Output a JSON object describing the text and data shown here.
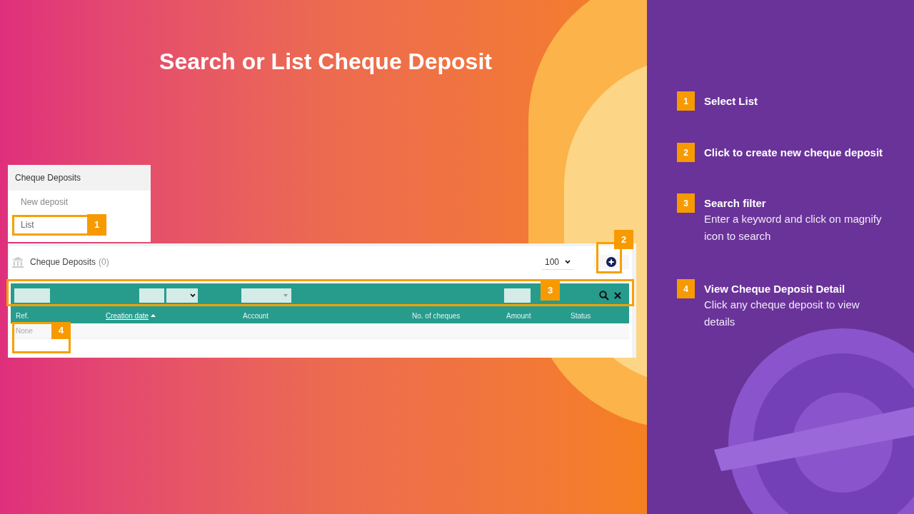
{
  "title": "Search or List Cheque Deposit",
  "menu": {
    "heading": "Cheque Deposits",
    "items": [
      {
        "label": "New deposit",
        "selected": false
      },
      {
        "label": "List",
        "selected": true
      }
    ]
  },
  "list_panel": {
    "title": "Cheque Deposits",
    "count": "(0)",
    "page_size": "100",
    "columns": [
      {
        "label": "Ref.",
        "sorted": false
      },
      {
        "label": "Creation date",
        "sorted": true
      },
      {
        "label": "Account",
        "sorted": false
      },
      {
        "label": "No. of cheques",
        "sorted": false
      },
      {
        "label": "Amount",
        "sorted": false
      },
      {
        "label": "Status",
        "sorted": false
      }
    ],
    "empty_text": "None"
  },
  "callouts": [
    "1",
    "2",
    "3",
    "4"
  ],
  "steps": [
    {
      "number": "1",
      "title": "Select List"
    },
    {
      "number": "2",
      "title": "Click to create new cheque deposit"
    },
    {
      "number": "3",
      "title": "Search filter",
      "text": "Enter a keyword and click on magnify icon to search"
    },
    {
      "number": "4",
      "title": "View Cheque Deposit Detail",
      "text": "Click any cheque deposit to view details"
    }
  ]
}
